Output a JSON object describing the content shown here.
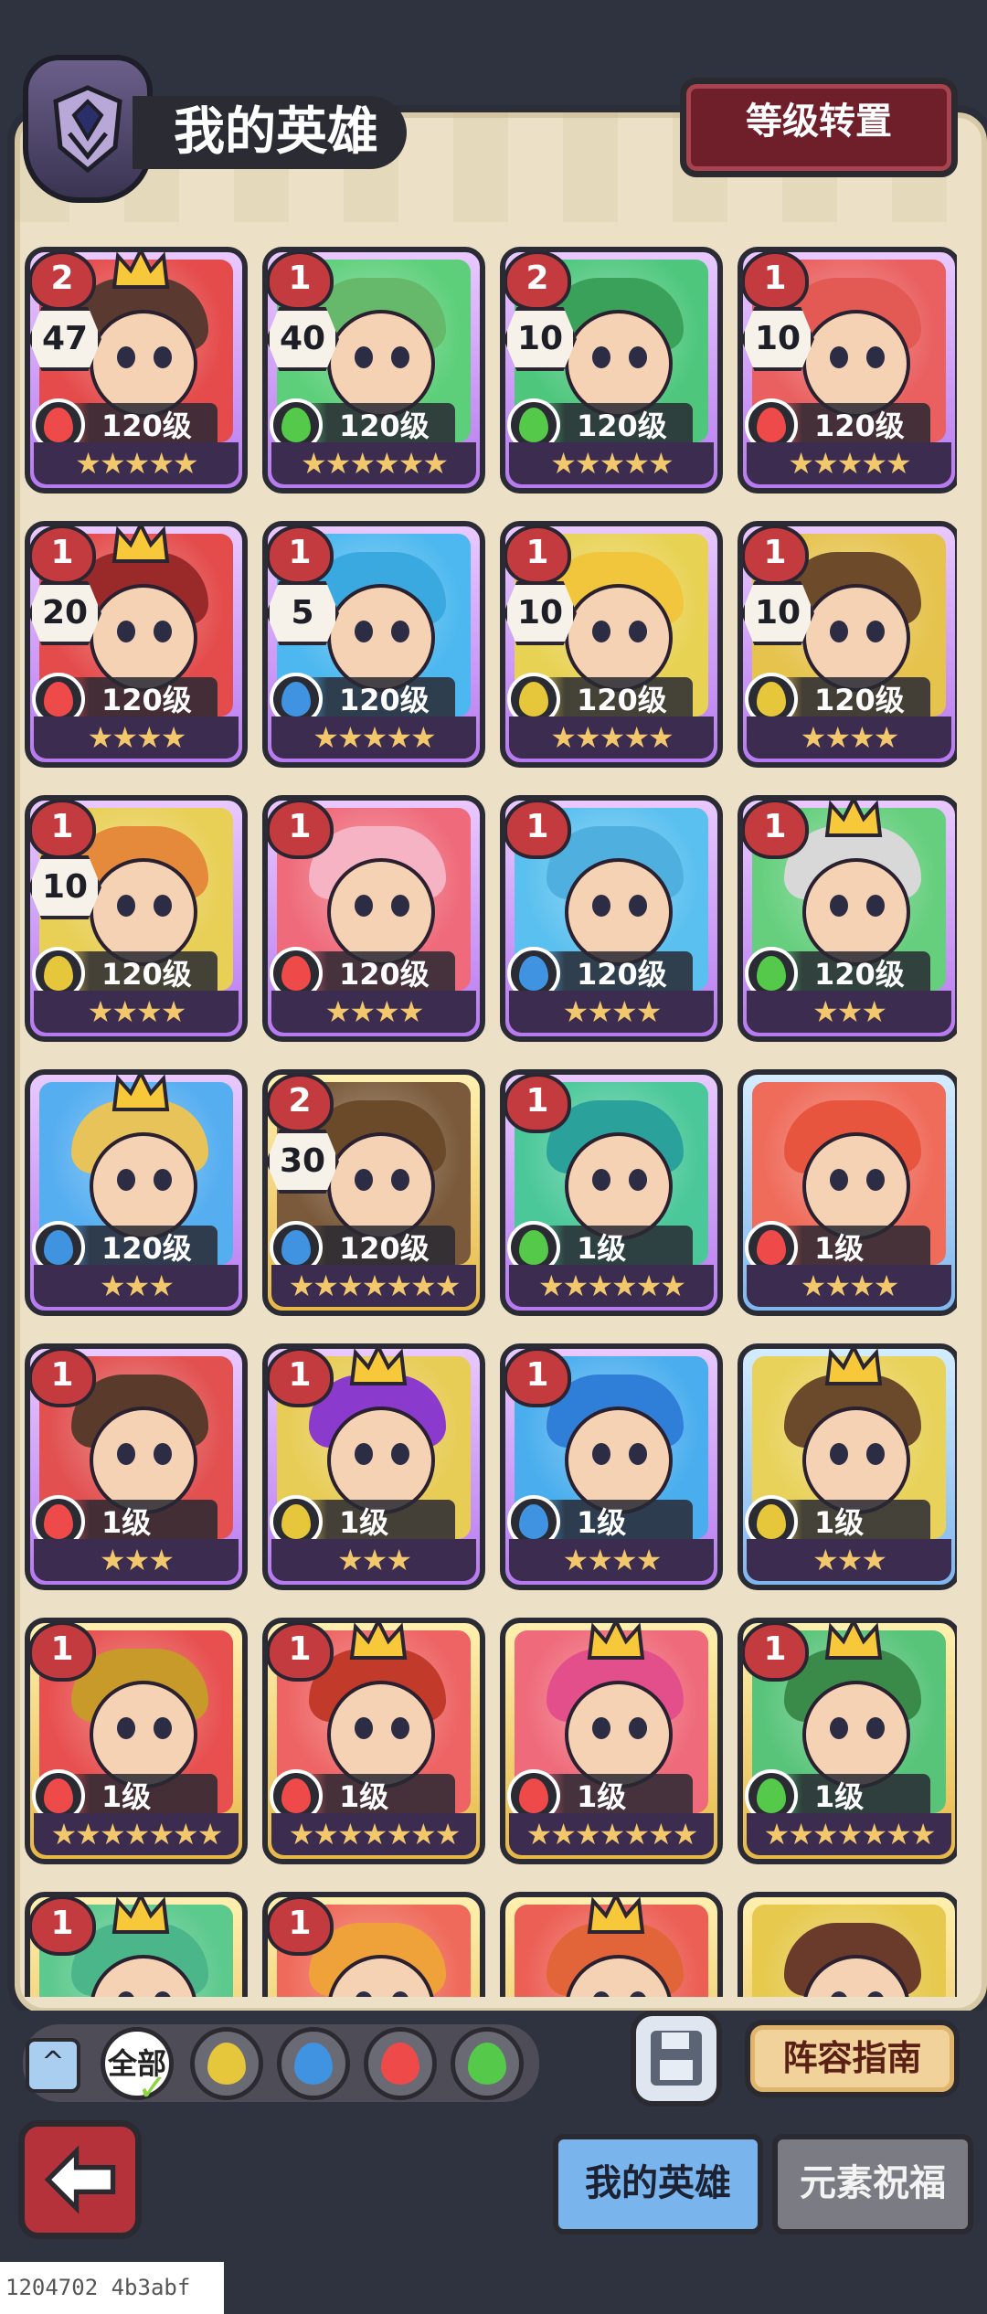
{
  "header": {
    "title": "我的英雄",
    "reset_button": "等级转置"
  },
  "heroes": [
    {
      "tier": "2",
      "count": "47",
      "crown": true,
      "element": "fire",
      "level": "120级",
      "stars": "★★★★★",
      "frame": "purple",
      "hair": "#5a3a30",
      "bg": "#e54b4b"
    },
    {
      "tier": "1",
      "count": "40",
      "crown": false,
      "element": "wind",
      "level": "120级",
      "stars": "★★★★★★",
      "frame": "purple",
      "hair": "#66b86a",
      "bg": "#5dcf7a"
    },
    {
      "tier": "2",
      "count": "10",
      "crown": false,
      "element": "wind",
      "level": "120级",
      "stars": "★★★★★",
      "frame": "purple",
      "hair": "#3aa15a",
      "bg": "#4ec77d"
    },
    {
      "tier": "1",
      "count": "10",
      "crown": false,
      "element": "fire",
      "level": "120级",
      "stars": "★★★★★",
      "frame": "purple",
      "hair": "#e35a54",
      "bg": "#ea5f5f"
    },
    {
      "tier": "1",
      "count": "20",
      "crown": true,
      "element": "fire",
      "level": "120级",
      "stars": "★★★★",
      "frame": "purple",
      "hair": "#9a2a2a",
      "bg": "#e44c4c"
    },
    {
      "tier": "1",
      "count": "5",
      "crown": false,
      "element": "water",
      "level": "120级",
      "stars": "★★★★★",
      "frame": "purple",
      "hair": "#39a9e0",
      "bg": "#4cb8ef"
    },
    {
      "tier": "1",
      "count": "10",
      "crown": false,
      "element": "earth",
      "level": "120级",
      "stars": "★★★★★",
      "frame": "purple",
      "hair": "#f1c53c",
      "bg": "#e8d254"
    },
    {
      "tier": "1",
      "count": "10",
      "crown": false,
      "element": "earth",
      "level": "120级",
      "stars": "★★★★",
      "frame": "purple",
      "hair": "#6d4a2a",
      "bg": "#e6c34d"
    },
    {
      "tier": "1",
      "count": "10",
      "crown": false,
      "element": "earth",
      "level": "120级",
      "stars": "★★★★",
      "frame": "purple",
      "hair": "#e58a3a",
      "bg": "#e8cf56"
    },
    {
      "tier": "1",
      "count": "",
      "crown": false,
      "element": "fire",
      "level": "120级",
      "stars": "★★★★",
      "frame": "purple",
      "hair": "#f5b3c3",
      "bg": "#ef6b7b"
    },
    {
      "tier": "1",
      "count": "",
      "crown": false,
      "element": "water",
      "level": "120级",
      "stars": "★★★★",
      "frame": "purple",
      "hair": "#4fb0e0",
      "bg": "#5ac0ef"
    },
    {
      "tier": "1",
      "count": "",
      "crown": true,
      "element": "wind",
      "level": "120级",
      "stars": "★★★",
      "frame": "purple",
      "hair": "#d8d8d8",
      "bg": "#66cf7e"
    },
    {
      "tier": "",
      "count": "",
      "crown": true,
      "element": "water",
      "level": "120级",
      "stars": "★★★",
      "frame": "purple",
      "hair": "#e7c35a",
      "bg": "#55aef0"
    },
    {
      "tier": "2",
      "count": "30",
      "crown": false,
      "element": "water",
      "level": "120级",
      "stars": "★★★★★★★",
      "frame": "gold",
      "hair": "#6b4a2a",
      "bg": "#7a5a3a"
    },
    {
      "tier": "1",
      "count": "",
      "crown": false,
      "element": "wind",
      "level": "1级",
      "stars": "★★★★★★",
      "frame": "purple",
      "hair": "#2aa19b",
      "bg": "#4bc89a"
    },
    {
      "tier": "",
      "count": "",
      "crown": false,
      "element": "fire",
      "level": "1级",
      "stars": "★★★★",
      "frame": "blue",
      "hair": "#e8553f",
      "bg": "#ef6b5a"
    },
    {
      "tier": "1",
      "count": "",
      "crown": false,
      "element": "fire",
      "level": "1级",
      "stars": "★★★",
      "frame": "purple",
      "hair": "#5a3a2a",
      "bg": "#e25050"
    },
    {
      "tier": "1",
      "count": "",
      "crown": true,
      "element": "earth",
      "level": "1级",
      "stars": "★★★",
      "frame": "purple",
      "hair": "#8a3acd",
      "bg": "#e7cc55"
    },
    {
      "tier": "1",
      "count": "",
      "crown": false,
      "element": "water",
      "level": "1级",
      "stars": "★★★★",
      "frame": "purple",
      "hair": "#2f7ed8",
      "bg": "#4aaeee"
    },
    {
      "tier": "",
      "count": "",
      "crown": true,
      "element": "earth",
      "level": "1级",
      "stars": "★★★",
      "frame": "blue",
      "hair": "#6a4a2a",
      "bg": "#e8d25a"
    },
    {
      "tier": "1",
      "count": "",
      "crown": false,
      "element": "fire",
      "level": "1级",
      "stars": "★★★★★★★",
      "frame": "gold",
      "hair": "#c89a2a",
      "bg": "#e85050"
    },
    {
      "tier": "1",
      "count": "",
      "crown": true,
      "element": "fire",
      "level": "1级",
      "stars": "★★★★★★★",
      "frame": "gold",
      "hair": "#c23a2a",
      "bg": "#ee6464"
    },
    {
      "tier": "",
      "count": "",
      "crown": true,
      "element": "fire",
      "level": "1级",
      "stars": "★★★★★★★",
      "frame": "gold",
      "hair": "#e24f8a",
      "bg": "#ef6a7a"
    },
    {
      "tier": "1",
      "count": "",
      "crown": true,
      "element": "wind",
      "level": "1级",
      "stars": "★★★★★★★",
      "frame": "gold",
      "hair": "#3a8a4a",
      "bg": "#58c47a"
    },
    {
      "tier": "1",
      "count": "",
      "crown": true,
      "element": "wind",
      "level": "",
      "stars": "",
      "frame": "gold",
      "hair": "#4bb68a",
      "bg": "#5cc98d"
    },
    {
      "tier": "1",
      "count": "",
      "crown": false,
      "element": "fire",
      "level": "",
      "stars": "",
      "frame": "gold",
      "hair": "#f0a23a",
      "bg": "#ef6a5a"
    },
    {
      "tier": "",
      "count": "",
      "crown": true,
      "element": "fire",
      "level": "",
      "stars": "",
      "frame": "gold",
      "hair": "#e2653a",
      "bg": "#ec5f55"
    },
    {
      "tier": "",
      "count": "",
      "crown": false,
      "element": "earth",
      "level": "",
      "stars": "",
      "frame": "gold",
      "hair": "#6a3a2a",
      "bg": "#e6c94d"
    }
  ],
  "element_colors": {
    "fire": "#ef4a4a",
    "wind": "#55c94a",
    "water": "#3f93e0",
    "earth": "#e6c63a"
  },
  "filters": {
    "all_label": "全部",
    "collapse_icon": "^"
  },
  "actions": {
    "guide_button": "阵容指南",
    "back_icon": "back-arrow-icon",
    "save_icon": "floppy-disk-icon"
  },
  "tabs": {
    "my_heroes": "我的英雄",
    "element_blessing": "元素祝福"
  },
  "footer": {
    "id_text": "1204702 4b3abf"
  }
}
